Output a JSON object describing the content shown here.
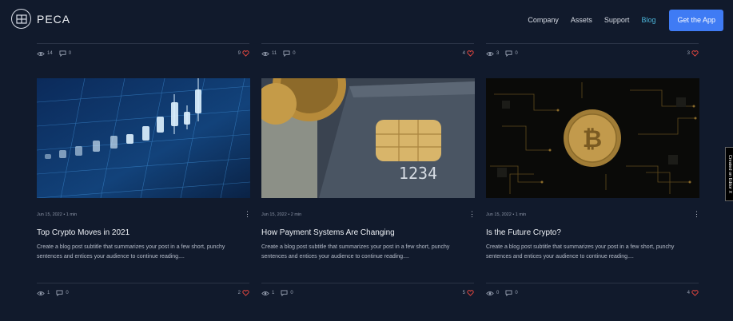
{
  "brand": {
    "name": "PECA"
  },
  "nav": {
    "links": [
      "Company",
      "Assets",
      "Support",
      "Blog"
    ],
    "active": "Blog",
    "cta": "Get the App"
  },
  "top_stats": [
    {
      "views": "14",
      "comments": "0",
      "likes": "9"
    },
    {
      "views": "11",
      "comments": "0",
      "likes": "4"
    },
    {
      "views": "3",
      "comments": "0",
      "likes": "3"
    }
  ],
  "posts": [
    {
      "date": "Jun 15, 2022",
      "read": "1 min",
      "title": "Top Crypto Moves in 2021",
      "excerpt": "Create a blog post subtitle that summarizes your post in a few short, punchy sentences and entices your audience to continue reading....",
      "views": "1",
      "comments": "0",
      "likes": "2",
      "image": "crypto-chart"
    },
    {
      "date": "Jun 15, 2022",
      "read": "2 min",
      "title": "How Payment Systems Are Changing",
      "excerpt": "Create a blog post subtitle that summarizes your post in a few short, punchy sentences and entices your audience to continue reading....",
      "views": "1",
      "comments": "0",
      "likes": "5",
      "image": "credit-card",
      "card_number": "1234"
    },
    {
      "date": "Jun 15, 2022",
      "read": "1 min",
      "title": "Is the Future Crypto?",
      "excerpt": "Create a blog post subtitle that summarizes your post in a few short, punchy sentences and entices your audience to continue reading....",
      "views": "0",
      "comments": "0",
      "likes": "4",
      "image": "bitcoin-circuit",
      "coin_symbol": "₿"
    }
  ],
  "side_tab": "Created on Editor X",
  "colors": {
    "bg": "#111a2c",
    "accent": "#3f7bf4",
    "active_link": "#4bb4d8",
    "heart": "#e0463f"
  }
}
